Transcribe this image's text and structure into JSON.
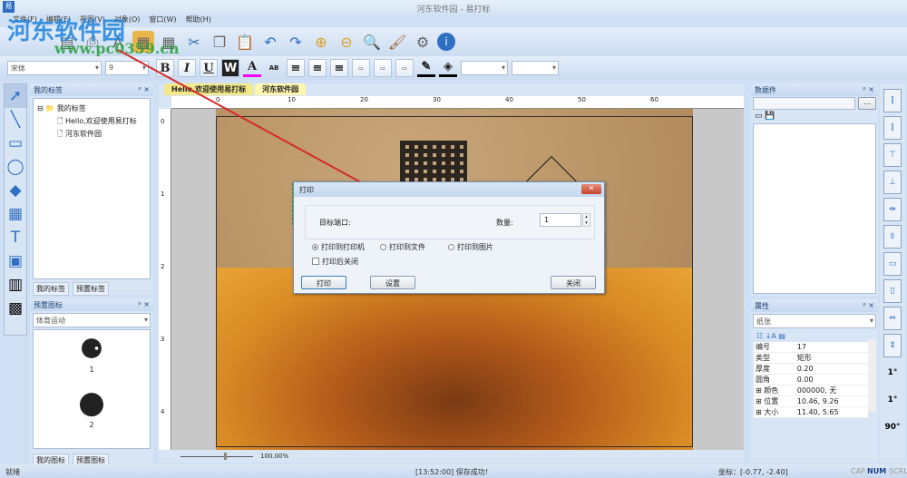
{
  "window": {
    "title": "河东软件园 - 易打标",
    "app_icon": "易"
  },
  "menu": [
    "文件(F)",
    "编辑(E)",
    "视图(V)",
    "对象(O)",
    "窗口(W)",
    "帮助(H)"
  ],
  "watermark": {
    "text": "河东软件园",
    "url": "www.pc0359.cn"
  },
  "toolbar": {
    "icons": [
      "new-icon",
      "open-icon",
      "save-icon",
      "print-icon",
      "text-icon",
      "grid-icon",
      "table-icon",
      "cut-icon",
      "copy-icon",
      "paste-icon",
      "undo-icon",
      "redo-icon",
      "zoom-in-icon",
      "zoom-out-icon",
      "zoom-fit-icon",
      "clear-icon",
      "settings-icon",
      "info-icon"
    ]
  },
  "format": {
    "font": "宋体",
    "size": "9",
    "bold": "B",
    "italic": "I",
    "underline": "U",
    "wrap": "W",
    "font_color": "A",
    "highlight": "AB",
    "font_color_hex": "#ff00ff"
  },
  "left_panel": {
    "title": "我的标签",
    "root": "我的标签",
    "items": [
      "Hello,欢迎使用易打标",
      "河东软件园"
    ],
    "tabs": [
      "我的标签",
      "预置标签"
    ]
  },
  "preset_panel": {
    "title": "预置图标",
    "category": "体育运动",
    "items": [
      "1",
      "2"
    ],
    "tabs": [
      "我的图标",
      "预置图标"
    ]
  },
  "doc_tabs": [
    "Hello,欢迎使用易打标",
    "河东软件园"
  ],
  "ruler": {
    "h": [
      "0",
      "10",
      "20",
      "30",
      "40",
      "50",
      "60"
    ],
    "v": [
      "0",
      "1",
      "2",
      "3",
      "4"
    ]
  },
  "zoom": "100.00%",
  "dialog": {
    "title": "打印",
    "target_label": "目标端口:",
    "qty_label": "数量:",
    "qty": "1",
    "radios": [
      "打印到打印机",
      "打印到文件",
      "打印到图片"
    ],
    "selected": "打印到打印机",
    "close_after": "打印后关闭",
    "close_after_checked": false,
    "print": "打印",
    "setup": "设置",
    "close": "关闭"
  },
  "data_panel": {
    "title": "数据件",
    "browse": "..."
  },
  "props": {
    "title": "属性",
    "selector": "纸张",
    "rows": [
      [
        "编号",
        "17"
      ],
      [
        "类型",
        "矩形"
      ],
      [
        "厚度",
        "0.20"
      ],
      [
        "圆角",
        "0.00"
      ],
      [
        "颜色",
        "000000, 无"
      ],
      [
        "位置",
        "10.46, 9.26"
      ],
      [
        "大小",
        "11.40, 5.65"
      ]
    ]
  },
  "right_tools": [
    "1°",
    "1°",
    "90°"
  ],
  "status": {
    "left": "就绪",
    "msg": "[13:52:00] 保存成功！",
    "coord": "坐标：[-0.77, -2.40]",
    "cap": "CAP",
    "num": "NUM",
    "scrl": "SCRL"
  }
}
